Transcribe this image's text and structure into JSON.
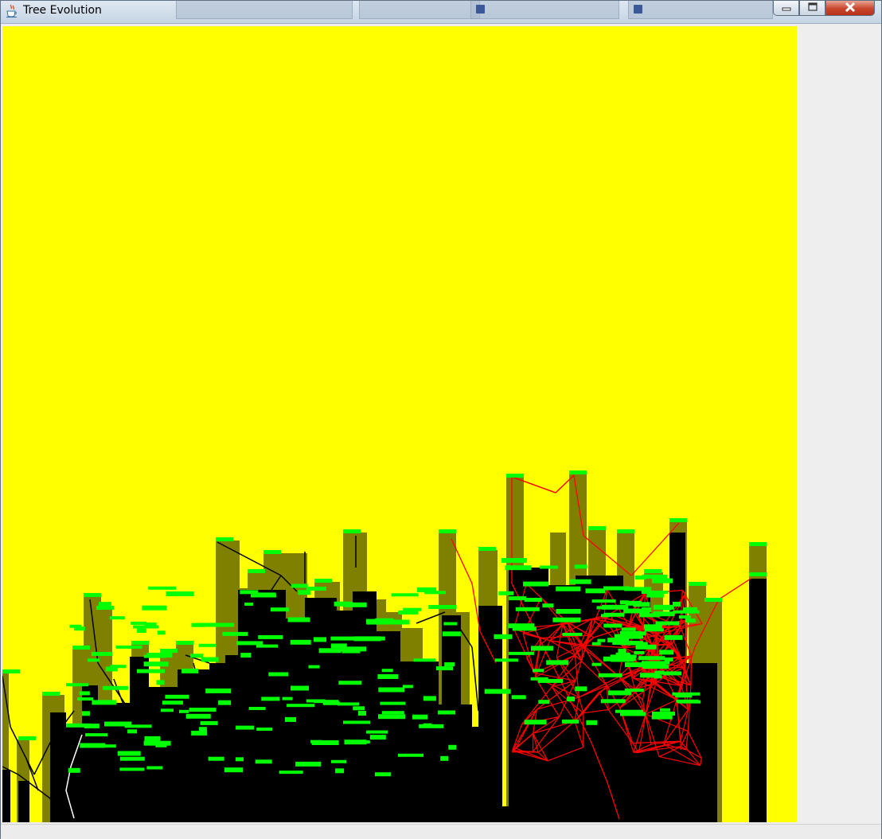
{
  "window": {
    "title": "Tree Evolution",
    "app_icon": "java-coffee-cup-icon",
    "controls": {
      "minimize_icon": "minimize-icon",
      "maximize_icon": "maximize-icon",
      "close_icon": "close-icon"
    }
  },
  "simulation": {
    "sky_color": "#ffff00",
    "trunk_color": "#000000",
    "shade_color": "#808000",
    "leaf_color": "#00ff00",
    "highlight_branch_color": "#ff0000",
    "branch_color": "#000000"
  }
}
